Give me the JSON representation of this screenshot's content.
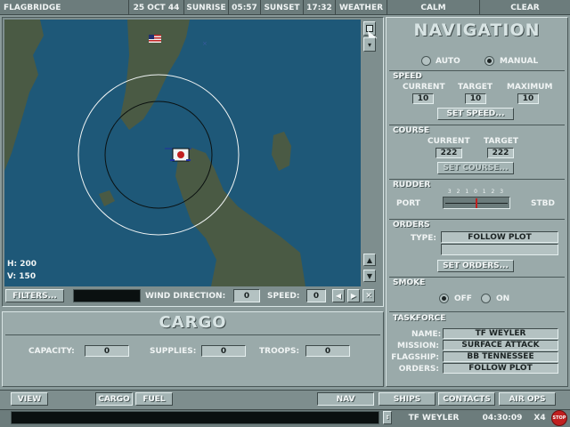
{
  "topbar": {
    "app_name": "FLAGBRIDGE",
    "date": "25 OCT 44",
    "sunrise_label": "SUNRISE",
    "sunrise_time": "05:57",
    "sunset_label": "SUNSET",
    "sunset_time": "17:32",
    "weather_label": "WEATHER",
    "sea_state": "CALM",
    "sky": "CLEAR"
  },
  "map": {
    "height_readout": "H: 200",
    "visibility_readout": "V: 150",
    "colors": {
      "sea": "#1e5878",
      "land": "#4a5a44",
      "outer_ring": "#f0f4f4",
      "inner_ring": "#0a1010"
    }
  },
  "map_controls": {
    "filters_label": "FILTERS...",
    "wind_direction_label": "WIND DIRECTION:",
    "wind_direction_value": "0",
    "speed_label": "SPEED:",
    "speed_value": "0"
  },
  "cargo": {
    "title": "CARGO",
    "capacity_label": "CAPACITY:",
    "capacity_value": "0",
    "supplies_label": "SUPPLIES:",
    "supplies_value": "0",
    "troops_label": "TROOPS:",
    "troops_value": "0"
  },
  "navigation": {
    "title": "NAVIGATION",
    "mode_auto": "AUTO",
    "mode_manual": "MANUAL",
    "speed": {
      "title": "SPEED",
      "current_label": "CURRENT",
      "target_label": "TARGET",
      "maximum_label": "MAXIMUM",
      "current": "10",
      "target": "10",
      "maximum": "10",
      "set_button": "SET SPEED..."
    },
    "course": {
      "title": "COURSE",
      "current_label": "CURRENT",
      "target_label": "TARGET",
      "current": "222",
      "target": "222",
      "set_button": "SET COURSE..."
    },
    "rudder": {
      "title": "RUDDER",
      "port_label": "PORT",
      "stbd_label": "STBD",
      "scale": "3 2 1 0 1 2 3"
    },
    "orders": {
      "title": "ORDERS",
      "type_label": "TYPE:",
      "type_value": "FOLLOW PLOT",
      "set_button": "SET ORDERS..."
    },
    "smoke": {
      "title": "SMOKE",
      "off": "OFF",
      "on": "ON"
    },
    "taskforce": {
      "title": "TASKFORCE",
      "name_label": "NAME:",
      "name": "TF WEYLER",
      "mission_label": "MISSION:",
      "mission": "SURFACE ATTACK",
      "flagship_label": "FLAGSHIP:",
      "flagship": "BB TENNESSEE",
      "orders_label": "ORDERS:",
      "orders": "FOLLOW PLOT"
    }
  },
  "bottom_tabs": {
    "view": "VIEW",
    "cargo": "CARGO",
    "fuel": "FUEL",
    "nav": "NAV",
    "ships": "SHIPS",
    "contacts": "CONTACTS",
    "air_ops": "AIR OPS"
  },
  "statusbar": {
    "taskforce": "TF WEYLER",
    "clock": "04:30:09",
    "time_scale": "x4",
    "stop_label": "STOP"
  }
}
